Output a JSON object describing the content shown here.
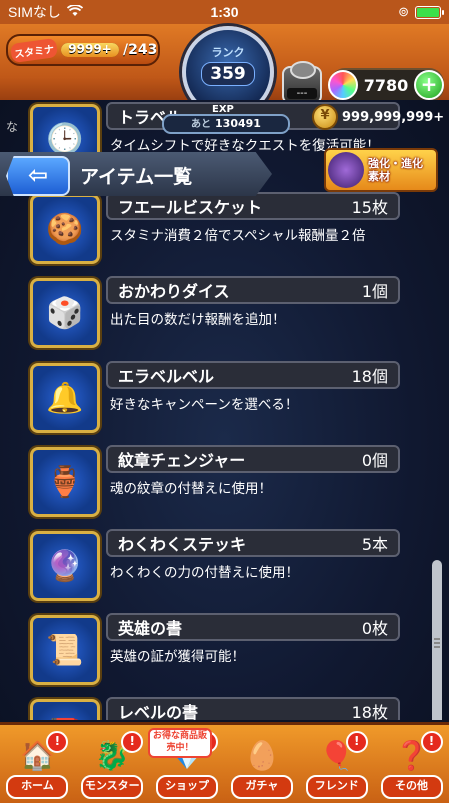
{
  "status_bar": {
    "carrier": "SIMなし",
    "time": "1:30"
  },
  "header": {
    "stamina_label": "スタミナ",
    "stamina_current": "9999+",
    "stamina_max": "/243",
    "rank_label": "ランク",
    "rank_value": "359",
    "exp_label": "EXP",
    "exp_prefix": "あと",
    "exp_remaining": "130491",
    "gift_text": "---",
    "orb_count": "7780",
    "gold_count": "999,999,999+"
  },
  "title_bar": {
    "title": "アイテム一覧",
    "evolve_label_line1": "強化・進化",
    "evolve_label_line2": "素材"
  },
  "side_text": "な",
  "items": [
    {
      "name": "トラベル",
      "count": "",
      "desc": "タイムシフトで好きなクエストを復活可能！",
      "icon": "🕒"
    },
    {
      "name": "フエールビスケット",
      "count": "15枚",
      "desc": "スタミナ消費２倍でスペシャル報酬量２倍",
      "icon": "🍪"
    },
    {
      "name": "おかわりダイス",
      "count": "1個",
      "desc": "出た目の数だけ報酬を追加！",
      "icon": "🎲"
    },
    {
      "name": "エラベルベル",
      "count": "18個",
      "desc": "好きなキャンペーンを選べる！",
      "icon": "🔔"
    },
    {
      "name": "紋章チェンジャー",
      "count": "0個",
      "desc": "魂の紋章の付替えに使用！",
      "icon": "🏺"
    },
    {
      "name": "わくわくステッキ",
      "count": "5本",
      "desc": "わくわくの力の付替えに使用！",
      "icon": "🔮"
    },
    {
      "name": "英雄の書",
      "count": "0枚",
      "desc": "英雄の証が獲得可能！",
      "icon": "📜"
    },
    {
      "name": "レベルの書",
      "count": "18枚",
      "desc": "",
      "icon": "📕"
    }
  ],
  "bottom_nav": {
    "sale_tag": "お得な商品販売中！",
    "items": [
      {
        "label": "ホーム",
        "icon": "🏠",
        "badge": "!"
      },
      {
        "label": "モンスター",
        "icon": "🐉",
        "badge": "!"
      },
      {
        "label": "ショップ",
        "icon": "💎",
        "badge": "!"
      },
      {
        "label": "ガチャ",
        "icon": "🥚",
        "badge": ""
      },
      {
        "label": "フレンド",
        "icon": "🎈",
        "badge": "!"
      },
      {
        "label": "その他",
        "icon": "❓",
        "badge": "!"
      }
    ]
  },
  "colors": {
    "header": "#c05818",
    "accent_blue": "#1e5fd4",
    "gold_border": "#d9b043"
  }
}
